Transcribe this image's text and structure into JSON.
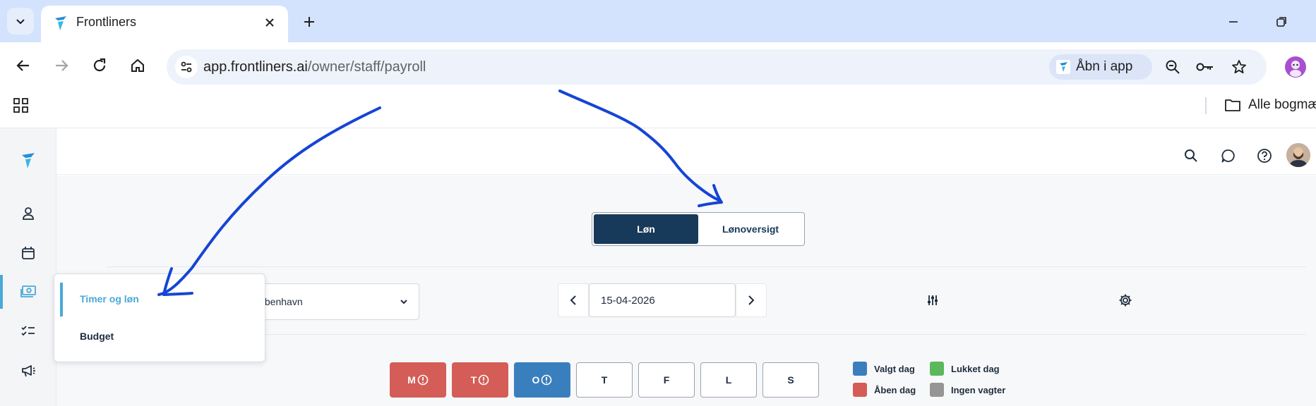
{
  "browser": {
    "tab_title": "Frontliners",
    "url_domain": "app.frontliners.ai",
    "url_path": "/owner/staff/payroll",
    "open_in_app_label": "Åbn i app",
    "bookmarks_folder_label": "Alle bogmærker",
    "profile_color": "#a84fd0"
  },
  "app": {
    "brand_color": "#183a5a",
    "accent_color": "#4aa8d8",
    "segmented": {
      "active_label": "Løn",
      "inactive_label": "Lønoversigt"
    },
    "location_select_text": "København",
    "date_value": "15-04-2026",
    "dropdown": {
      "items": [
        "Timer og løn",
        "Budget"
      ]
    },
    "day_buttons": [
      {
        "label": "M",
        "state": "red",
        "alert": true
      },
      {
        "label": "T",
        "state": "red",
        "alert": true
      },
      {
        "label": "O",
        "state": "blue",
        "alert": true
      },
      {
        "label": "T",
        "state": "white",
        "alert": false
      },
      {
        "label": "F",
        "state": "white",
        "alert": false
      },
      {
        "label": "L",
        "state": "white",
        "alert": false
      },
      {
        "label": "S",
        "state": "white",
        "alert": false
      }
    ],
    "legend": [
      {
        "label": "Valgt dag",
        "color": "#3a7fbd"
      },
      {
        "label": "Lukket dag",
        "color": "#5cb85c"
      },
      {
        "label": "Åben dag",
        "color": "#d45d57"
      },
      {
        "label": "Ingen vagter",
        "color": "#959595"
      }
    ]
  }
}
